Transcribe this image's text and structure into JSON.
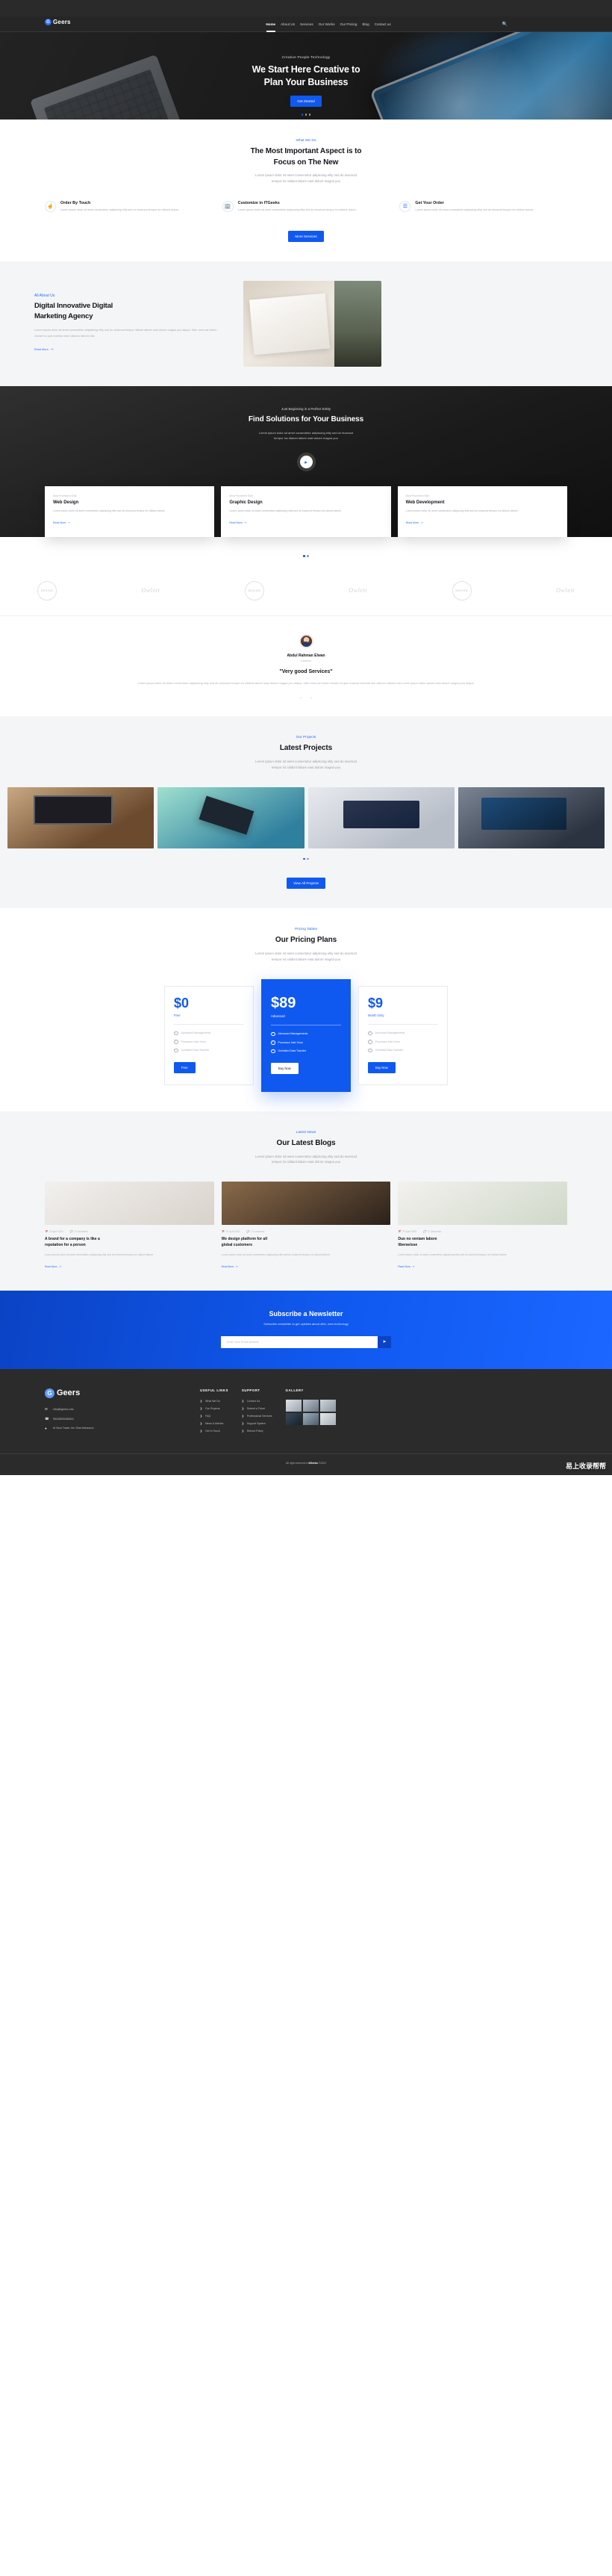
{
  "brand": {
    "name": "Geers",
    "logo_letter": "G"
  },
  "nav": {
    "items": [
      {
        "label": "Home",
        "active": true
      },
      {
        "label": "About Us",
        "active": false
      },
      {
        "label": "Services",
        "active": false
      },
      {
        "label": "Our Works",
        "active": false
      },
      {
        "label": "Our Pricing",
        "active": false
      },
      {
        "label": "Blog",
        "active": false
      },
      {
        "label": "Contact us",
        "active": false
      }
    ],
    "search_icon": "search-icon"
  },
  "hero": {
    "kicker": "Creative People Technology",
    "title_line1": "We Start Here Creative to",
    "title_line2": "Plan Your Business",
    "cta": "Get Started",
    "slide_count": 3,
    "active_slide": 1
  },
  "whatwedo": {
    "kicker": "What We Do",
    "title_line1": "The Most Important Aspect is to",
    "title_line2": "Focus on The New",
    "lead_line1": "Lorem ipsum dolor sit amet consectetur adipiscing elity sed do eiusmod",
    "lead_line2": "tempor inc ididunt labore east dolore magna you",
    "features": [
      {
        "icon": "hand-pointer-icon",
        "title": "Order By Touch",
        "text": "Lorem ipsum dolor sit amet consectetur adipiscing elity sed do eiusmod tempor inc ididunt dolore."
      },
      {
        "icon": "buildings-icon",
        "title": "Customize in ITGeeks",
        "text": "Lorem ipsum dolor sit amet consectetur adipiscing elity sed do eiusmod tempor inc ididunt dolore."
      },
      {
        "icon": "checklist-icon",
        "title": "Get Your Order",
        "text": "Lorem ipsum dolor sit amet consectetur adipiscing elity sed do eiusmod tempor inc ididunt dolore."
      }
    ],
    "cta": "More Services"
  },
  "about": {
    "kicker": "All About Us",
    "title_line1": "Digital Innovative Digital",
    "title_line2": "Marketing Agency",
    "text": "Lorem ipsum dolor sit amet consectetur adipisicing elity sed do eiusmod tempor ididunt labore east dolore magna you aliqua. Ulter enim ad minim veniam to quis nostrud ction ullamco laboris nisi.",
    "readmore": "Read More.. ➞"
  },
  "solutions": {
    "kicker": "Just Beginning in a Perfect Entity",
    "title": "Find Solutions for Your Business",
    "lead_line1": "Lorem ipsum dolor sit amet consectetur adipiscing elity sed do eiusmod",
    "lead_line2": "tempor inc ididunt labore east dolore magna you",
    "play_icon": "play-icon",
    "cards": [
      {
        "sub": "Most Prominent Side",
        "title": "Web Design",
        "text": "Lorem ipsum dolor sit amet consectetur adipiscing elity sed do eiusmod tempor inc ididunt labore",
        "link": "Read More.. ➞"
      },
      {
        "sub": "Most Prominent Side",
        "title": "Graphic Design",
        "text": "Lorem ipsum dolor sit amet consectetur adipiscing elity sed do eiusmod tempor inc ididunt labore",
        "link": "Read More.. ➞"
      },
      {
        "sub": "Most Prominent Side",
        "title": "Web Development",
        "text": "Lorem ipsum dolor sit amet consectetur adipiscing elity sed do eiusmod tempor inc ididunt labore",
        "link": "Read More.. ➞"
      }
    ],
    "slide_count": 2,
    "active_slide": 1
  },
  "clients": {
    "logos": [
      "DESIGN",
      "Owlett",
      "DESIGN",
      "Owlett",
      "DESIGN",
      "Owlett"
    ]
  },
  "testimonial": {
    "name": "Abdul Rahman Elwan",
    "role": "Customer",
    "quote": "\"Very good Services\"",
    "body": "Lorem ipsum dolor sit amet consectetur adipisicing elity sed do eiusmod tempor inc ididunt labore east dolore magna you aliqua. Ulter enim ad minim veniam to quis nostrud exercita tion ullamco laboris nisi.Lorem ipsum dolor labore east dolore magna you aliqua.",
    "prev_icon": "arrow-left-icon",
    "next_icon": "arrow-right-icon"
  },
  "projects": {
    "kicker": "Our Projects",
    "title": "Latest Projects",
    "lead_line1": "Lorem ipsum dolor sit amet consectetur adipiscing elity sed do eiusmod",
    "lead_line2": "tempor inc ididunt labore east dolore magna you",
    "cta": "View All Projects",
    "slide_count": 2,
    "active_slide": 1,
    "items": [
      "project-desk-setup",
      "project-green-cube",
      "project-laptop-chart",
      "project-dark-monitor"
    ]
  },
  "pricing": {
    "kicker": "Pricing Tables",
    "title": "Our Pricing Plans",
    "lead_line1": "Lorem ipsum dolor sit amet consectetur adipiscing elity sed do eiusmod",
    "lead_line2": "tempor inc ididunt labore east dolore magna you",
    "plans": [
      {
        "amount": "$0",
        "plan": "Free",
        "features": [
          "Advanced Managements",
          "Processor Intel Xeon",
          "Unlimited Data Transfer"
        ],
        "cta": "Free",
        "highlight": false
      },
      {
        "amount": "$89",
        "plan": "Advanced",
        "features": [
          "Advanced Managements",
          "Processor Intel Xeon",
          "Unlimited Data Transfer"
        ],
        "cta": "Buy Now",
        "highlight": true
      },
      {
        "amount": "$9",
        "plan": "Month Only",
        "features": [
          "Advanced Managements",
          "Processor Intel Xeon",
          "Unlimited Data Transfer"
        ],
        "cta": "Buy Now",
        "highlight": false
      }
    ]
  },
  "blog": {
    "kicker": "Latest News",
    "title": "Our Latest Blogs",
    "lead_line1": "Lorem ipsum dolor sit amet consectetur adipiscing elity sed do eiusmod",
    "lead_line2": "tempor inc ididunt labore east dolore magna you",
    "posts": [
      {
        "date": "20 April 2020",
        "comments": "3 Comments",
        "title_line1": "A brand for a company is like a",
        "title_line2": "reputation for a person",
        "text": "Lorem ipsum dolor sit amet consectetur adipiscing elity sed do eiusmod tempor inc ididunt labore",
        "link": "Read More.. ➞"
      },
      {
        "date": "20 April 2020",
        "comments": "3 Comments",
        "title_line1": "We design platform for all",
        "title_line2": "global customers",
        "text": "Lorem ipsum dolor sit amet consectetur adipiscing elity sed do eiusmod tempor inc ididunt labore",
        "link": "Read More.. ➞"
      },
      {
        "date": "20 April 2020",
        "comments": "3 Comments",
        "title_line1": "Duo no veniam labore",
        "title_line2": "liberavisse",
        "text": "Lorem ipsum dolor sit amet consectetur adipiscing elity sed do eiusmod tempor inc ididunt labore",
        "link": "Read More.. ➞"
      }
    ]
  },
  "newsletter": {
    "title": "Subscribe a Newsletter",
    "subtitle": "Subscribe newsletter to get updates about offer, new technology",
    "placeholder": "Enter Your Email address",
    "submit_icon": "paper-plane-icon"
  },
  "footer": {
    "brand": "Geers",
    "logo_letter": "G",
    "email": "info@itgeeks.info",
    "phone": "55048099489621",
    "address": "Al Noor Tower, Ibn Sina Mansoura",
    "useful_links": {
      "title": "USEFUL LINKS",
      "items": [
        "What We Do",
        "Our Projects",
        "FAQ",
        "News & Articles",
        "Get In Touch"
      ]
    },
    "support": {
      "title": "SUPPORT",
      "items": [
        "Contact Us",
        "Submit a Ticket",
        "Professional Services",
        "Support System",
        "Refund Policy"
      ]
    },
    "gallery": {
      "title": "GALLERY",
      "count": 6
    },
    "copyright_prefix": "All right reserved to ",
    "copyright_brand": "itGeeks",
    "copyright_suffix": " ©2020"
  },
  "watermark": "易上收录帮帮"
}
